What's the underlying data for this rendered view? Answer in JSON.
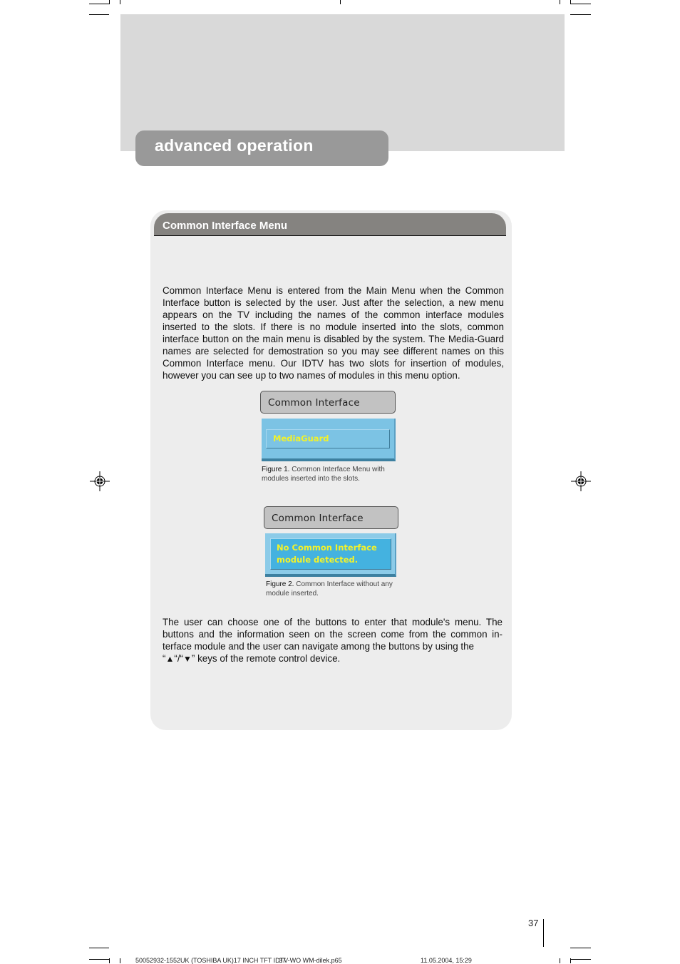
{
  "section": {
    "title": "advanced operation"
  },
  "card": {
    "title": "Common Interface Menu",
    "intro_paragraph": "Common Interface Menu is entered from the Main Menu when the Common Interface button is selected by the user. Just after the selection, a new menu appears on the TV including the names of the common interface modules inserted to the slots. If there is no module inserted into the slots, common interface button on the main menu is disabled by the system. The Media-Guard names are selected for demostration so you may see different names on this Common Interface menu. Our IDTV  has two slots for insertion of modules, however you can see up to two names of modules in this menu option.",
    "figures": [
      {
        "screen_title": "Common Interface",
        "lines": [
          "MediaGuard"
        ],
        "caption_label": "Figure 1.",
        "caption_text": " Common Interface Menu with modules inserted into the slots."
      },
      {
        "screen_title": "Common Interface",
        "lines": [
          "No Common Interface",
          "module detected."
        ],
        "caption_label": "Figure 2.",
        "caption_text": " Common Interface without any module inserted."
      }
    ],
    "closing_paragraph": {
      "text": "The user can choose one of the buttons to enter that module's menu. The buttons and the information seen on the screen come from the common in-terface module and the user can navigate among the buttons by using the",
      "open_quote": "“",
      "up_icon": "▲",
      "separator": "“/“",
      "down_icon": "▼",
      "tail": "” keys of the remote control device."
    }
  },
  "page_number": "37",
  "print_footer": {
    "file": "50052932-1552UK (TOSHIBA UK)17 INCH TFT IDTV-WO WM-dilek.p65",
    "overlap_page": "37",
    "date": "11.05.2004, 15:29"
  },
  "colors": {
    "header_band": "#d9d9d9",
    "section_tab": "#999999",
    "card_bg": "#ededed",
    "card_header": "#858380",
    "osd_blue": "#7cc3e4",
    "osd_text": "#f2f22a"
  }
}
